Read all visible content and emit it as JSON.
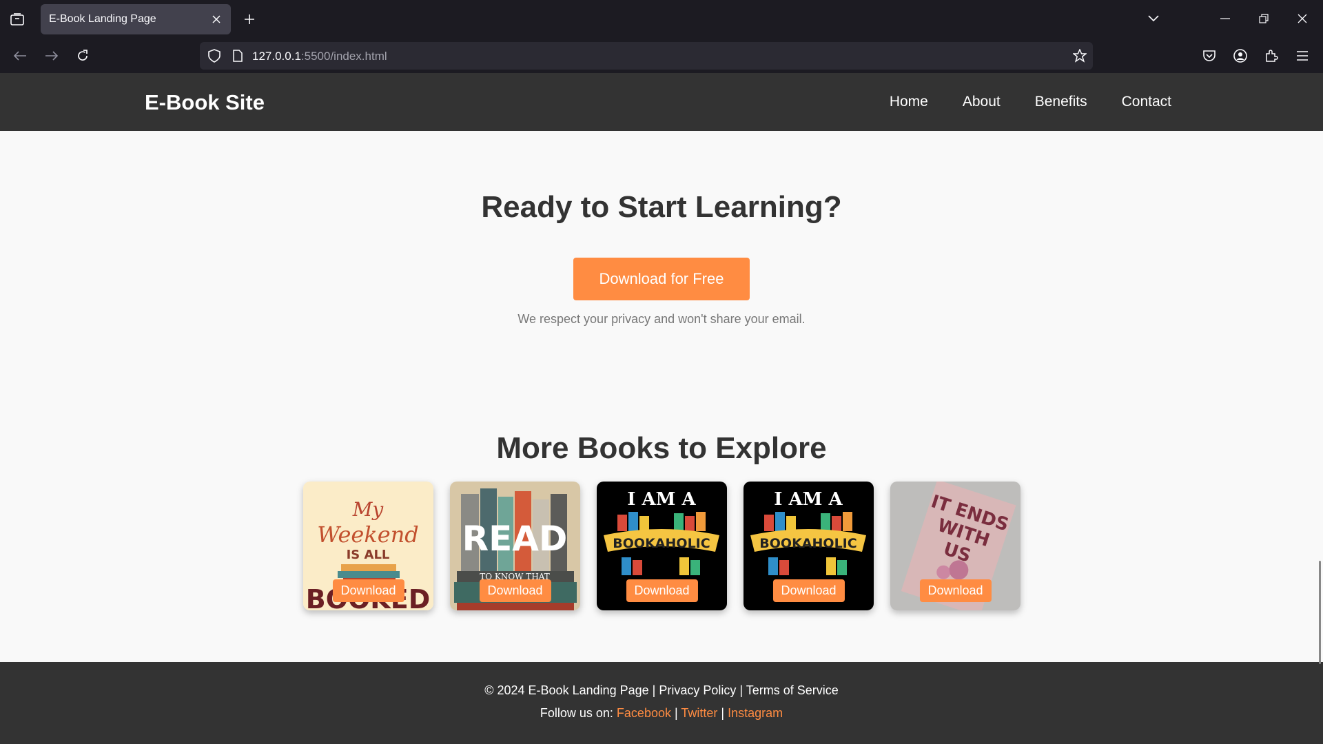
{
  "browser": {
    "tab_title": "E-Book Landing Page",
    "url_host": "127.0.0.1",
    "url_rest": ":5500/index.html"
  },
  "site": {
    "logo": "E-Book Site",
    "nav": [
      "Home",
      "About",
      "Benefits",
      "Contact"
    ]
  },
  "cta": {
    "title": "Ready to Start Learning?",
    "button": "Download for Free",
    "privacy": "We respect your privacy and won't share your email."
  },
  "more": {
    "title": "More Books to Explore",
    "books": [
      {
        "cover_text": "Sorry, My Weekend Is All Booked",
        "button": "Download"
      },
      {
        "cover_text": "We Read To Know That We're Not Alone",
        "button": "Download"
      },
      {
        "cover_text": "I Am A Bookaholic",
        "button": "Download"
      },
      {
        "cover_text": "I Am A Bookaholic",
        "button": "Download"
      },
      {
        "cover_text": "It Ends With Us — Colleen Hoover",
        "button": "Download"
      }
    ]
  },
  "footer": {
    "copyright": "© 2024 E-Book Landing Page | Privacy Policy | Terms of Service",
    "follow_label": "Follow us on:",
    "sep": "|",
    "links": [
      "Facebook",
      "Twitter",
      "Instagram"
    ]
  },
  "colors": {
    "accent": "#ff8c42",
    "header_bg": "#333333",
    "page_bg": "#f9f9f9"
  }
}
